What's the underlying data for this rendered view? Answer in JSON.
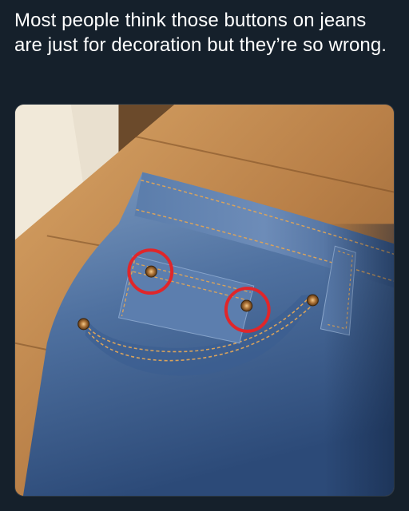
{
  "tweet": {
    "text": "Most people think those buttons on jeans are just for decoration but they’re so wrong."
  },
  "media": {
    "photo_subject": "jeans-pocket-rivets",
    "highlight_color": "#e0262a",
    "background_color": "#15202b"
  }
}
